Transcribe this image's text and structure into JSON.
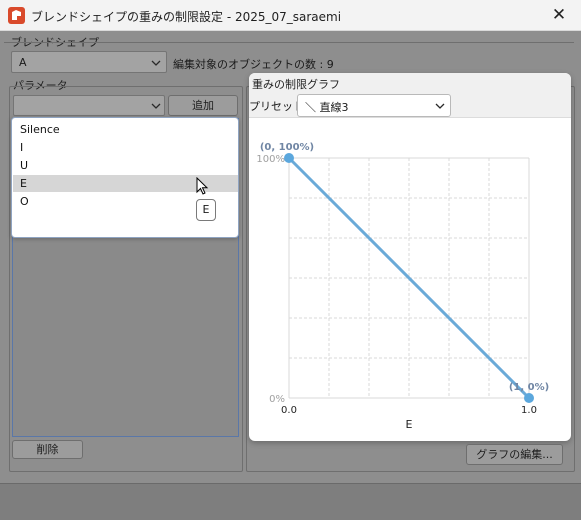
{
  "window": {
    "title": "ブレンドシェイプの重みの制限設定 - 2025_07_saraemi",
    "close_glyph": "✕"
  },
  "blendshape_group": {
    "label": "ブレンドシェイプ",
    "selected": "A",
    "info_text": "編集対象のオブジェクトの数 : 9"
  },
  "parameter_group": {
    "label": "パラメータ",
    "add_button": "追加",
    "delete_button": "削除"
  },
  "dropdown_list": {
    "items": [
      "Silence",
      "I",
      "U",
      "E",
      "O"
    ],
    "selected_index": 3
  },
  "tooltip": {
    "text": "E"
  },
  "graph_group": {
    "label": "重みの制限グラフ",
    "preset_label": "プリセット",
    "preset_value": "＼ 直線3",
    "edit_button": "グラフの編集..."
  },
  "chart_data": {
    "type": "line",
    "xlabel": "E",
    "ylabel": "",
    "xlim": [
      0.0,
      1.0
    ],
    "ylim": [
      0,
      100
    ],
    "x_tick_labels": [
      "0.0",
      "1.0"
    ],
    "y_tick_labels": [
      "100%",
      "0%"
    ],
    "grid": true,
    "grid_divisions": 6,
    "series": [
      {
        "x": [
          0.0,
          1.0
        ],
        "y": [
          100,
          0
        ],
        "color": "#6aaad8"
      }
    ],
    "annotations": [
      "(0, 100%)",
      "(1, 0%)"
    ]
  },
  "colors": {
    "curve": "#6aaad8",
    "point": "#5ba7dd",
    "accent": "#d94a2b"
  }
}
